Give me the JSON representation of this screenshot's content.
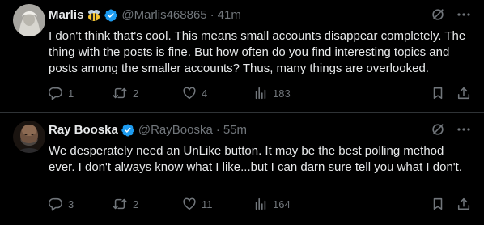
{
  "tweets": [
    {
      "author": "Marlis",
      "emoji": "bee-emoji",
      "handle": "@Marlis468865",
      "time": "41m",
      "text": "I don't think that's cool. This means small accounts disappear completely. The thing with the posts is fine. But how often do you find interesting topics and posts among the smaller accounts? Thus, many things are overlooked.",
      "replies": "1",
      "reposts": "2",
      "likes": "4",
      "views": "183"
    },
    {
      "author": "Ray Booska",
      "handle": "@RayBooska",
      "time": "55m",
      "text": "We desperately need an UnLike button. It may be the best polling method ever.  I don't always know what I like...but I can darn sure tell you what I don't.",
      "replies": "3",
      "reposts": "2",
      "likes": "11",
      "views": "164"
    }
  ],
  "separator": "·",
  "colors": {
    "background": "#000000",
    "text": "#e7e9ea",
    "muted": "#71767b",
    "verified": "#1d9bf0",
    "divider": "#2f3336"
  },
  "icons": [
    "verified-badge-icon",
    "grok-icon",
    "more-icon",
    "reply-icon",
    "repost-icon",
    "like-icon",
    "views-icon",
    "bookmark-icon",
    "share-icon"
  ]
}
